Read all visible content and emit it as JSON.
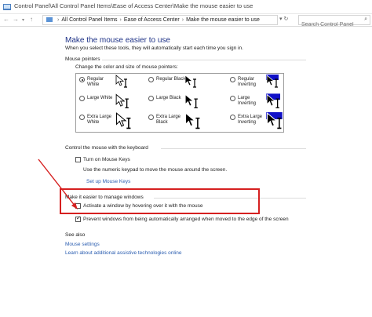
{
  "window": {
    "title": "Control Panel\\All Control Panel Items\\Ease of Access Center\\Make the mouse easier to use"
  },
  "address_bar": {
    "back_icon": "back-arrow-icon",
    "forward_icon": "forward-arrow-icon",
    "up_icon": "up-arrow-icon",
    "breadcrumbs": [
      "All Control Panel Items",
      "Ease of Access Center",
      "Make the mouse easier to use"
    ],
    "search_placeholder": "Search Control Panel"
  },
  "page": {
    "title": "Make the mouse easier to use",
    "intro": "When you select these tools, they will automatically start each time you sign in.",
    "mouse_pointers": {
      "heading": "Mouse pointers",
      "subheading": "Change the color and size of mouse pointers:",
      "options": [
        {
          "label_lines": [
            "Regular",
            "White"
          ],
          "checked": true,
          "style": "white"
        },
        {
          "label_lines": [
            "Regular Black"
          ],
          "checked": false,
          "style": "black"
        },
        {
          "label_lines": [
            "Regular",
            "Inverting"
          ],
          "checked": false,
          "style": "inverting"
        },
        {
          "label_lines": [
            "Large White"
          ],
          "checked": false,
          "style": "white"
        },
        {
          "label_lines": [
            "Large Black"
          ],
          "checked": false,
          "style": "black"
        },
        {
          "label_lines": [
            "Large",
            "Inverting"
          ],
          "checked": false,
          "style": "inverting"
        },
        {
          "label_lines": [
            "Extra Large",
            "White"
          ],
          "checked": false,
          "style": "white"
        },
        {
          "label_lines": [
            "Extra Large",
            "Black"
          ],
          "checked": false,
          "style": "black"
        },
        {
          "label_lines": [
            "Extra Large",
            "Inverting"
          ],
          "checked": false,
          "style": "inverting"
        }
      ]
    },
    "keyboard": {
      "heading": "Control the mouse with the keyboard",
      "mouse_keys_label": "Turn on Mouse Keys",
      "mouse_keys_checked": false,
      "description": "Use the numeric keypad to move the mouse around the screen.",
      "setup_link": "Set up Mouse Keys"
    },
    "windows": {
      "heading": "Make it easier to manage windows",
      "hover_label": "Activate a window by hovering over it with the mouse",
      "hover_checked": false,
      "arrange_label": "Prevent windows from being automatically arranged when moved to the edge of the screen",
      "arrange_checked": true
    },
    "see_also": {
      "heading": "See also",
      "links": [
        "Mouse settings",
        "Learn about additional assistive technologies online"
      ]
    }
  },
  "colors": {
    "accent_title": "#1e3287",
    "link": "#2a5db0",
    "annotation": "#d62020",
    "inverting_bg": "#1010c8"
  }
}
